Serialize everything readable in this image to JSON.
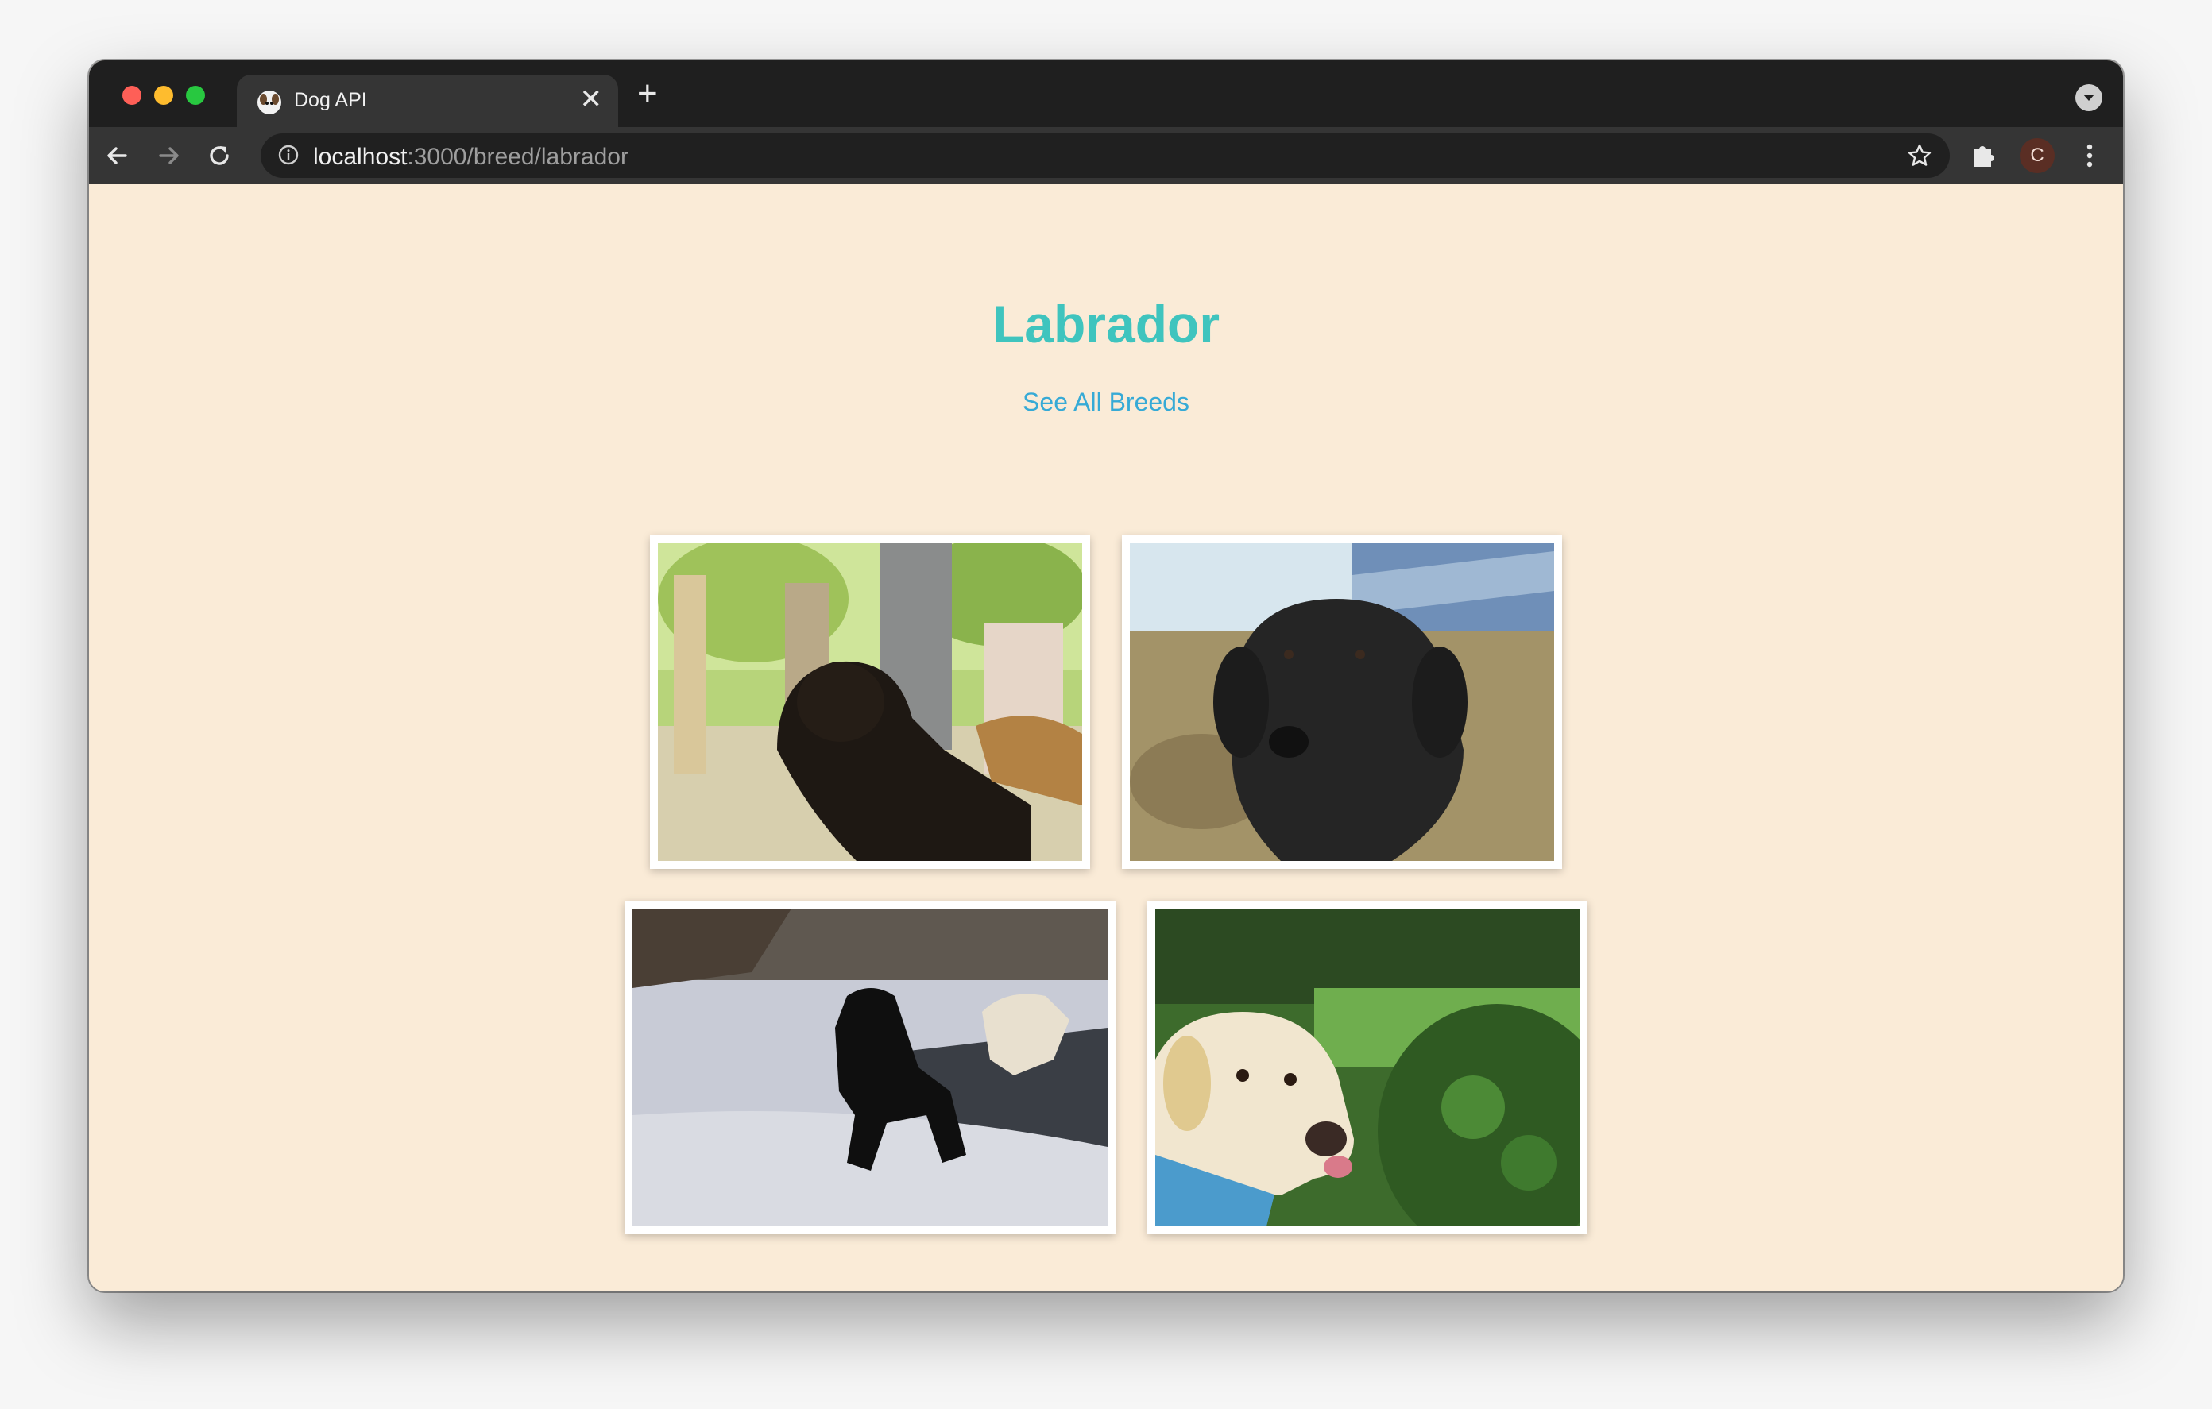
{
  "browser": {
    "tab_title": "Dog API",
    "url_host": "localhost",
    "url_path": ":3000/breed/labrador",
    "avatar_initial": "C"
  },
  "page": {
    "title": "Labrador",
    "link_label": "See All Breeds",
    "images": [
      {
        "alt": "black labrador at a gathering with people"
      },
      {
        "alt": "black labrador on grass"
      },
      {
        "alt": "black labrador running on snow"
      },
      {
        "alt": "yellow labrador in front of green bushes"
      }
    ]
  },
  "colors": {
    "page_background": "#faebd7",
    "title": "#3fc4be",
    "link": "#36aad6"
  },
  "icons": [
    "close-icon",
    "plus-icon",
    "back-arrow-icon",
    "forward-arrow-icon",
    "reload-icon",
    "info-icon",
    "star-icon",
    "puzzle-icon",
    "menu-dots-icon",
    "tab-search-icon"
  ]
}
